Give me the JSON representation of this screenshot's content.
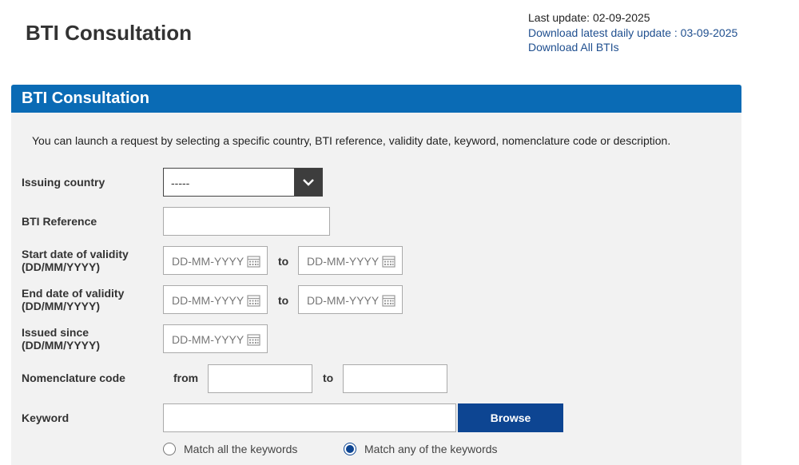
{
  "page_title": "BTI Consultation",
  "updates": {
    "last_update": "Last update: 02-09-2025",
    "daily_link": "Download latest daily update : 03-09-2025",
    "all_link": "Download All BTIs"
  },
  "panel": {
    "title": "BTI Consultation",
    "intro": "You can launch a request by selecting a specific country, BTI reference, validity date, keyword, nomenclature code or description."
  },
  "form": {
    "issuing_country": {
      "label": "Issuing country",
      "selected": "-----"
    },
    "bti_reference": {
      "label": "BTI Reference",
      "value": ""
    },
    "start_date": {
      "label_line1": "Start date of validity",
      "label_line2": "(DD/MM/YYYY)",
      "from_placeholder": "DD-MM-YYYY",
      "to_placeholder": "DD-MM-YYYY",
      "to_label": "to"
    },
    "end_date": {
      "label_line1": "End date of validity",
      "label_line2": "(DD/MM/YYYY)",
      "from_placeholder": "DD-MM-YYYY",
      "to_placeholder": "DD-MM-YYYY",
      "to_label": "to"
    },
    "issued_since": {
      "label_line1": "Issued since",
      "label_line2": "(DD/MM/YYYY)",
      "placeholder": "DD-MM-YYYY"
    },
    "nomenclature": {
      "label": "Nomenclature code",
      "from_label": "from",
      "to_label": "to"
    },
    "keyword": {
      "label": "Keyword",
      "browse_label": "Browse"
    },
    "match_options": [
      {
        "label": "Match all the keywords",
        "selected": false
      },
      {
        "label": "Match any of the keywords",
        "selected": true
      }
    ]
  },
  "colors": {
    "header_blue": "#0a6bb5",
    "button_navy": "#0d4592",
    "link_blue": "#1f4f8f"
  },
  "icons": {
    "dropdown": "chevron-down-icon",
    "date": "calendar-icon"
  }
}
